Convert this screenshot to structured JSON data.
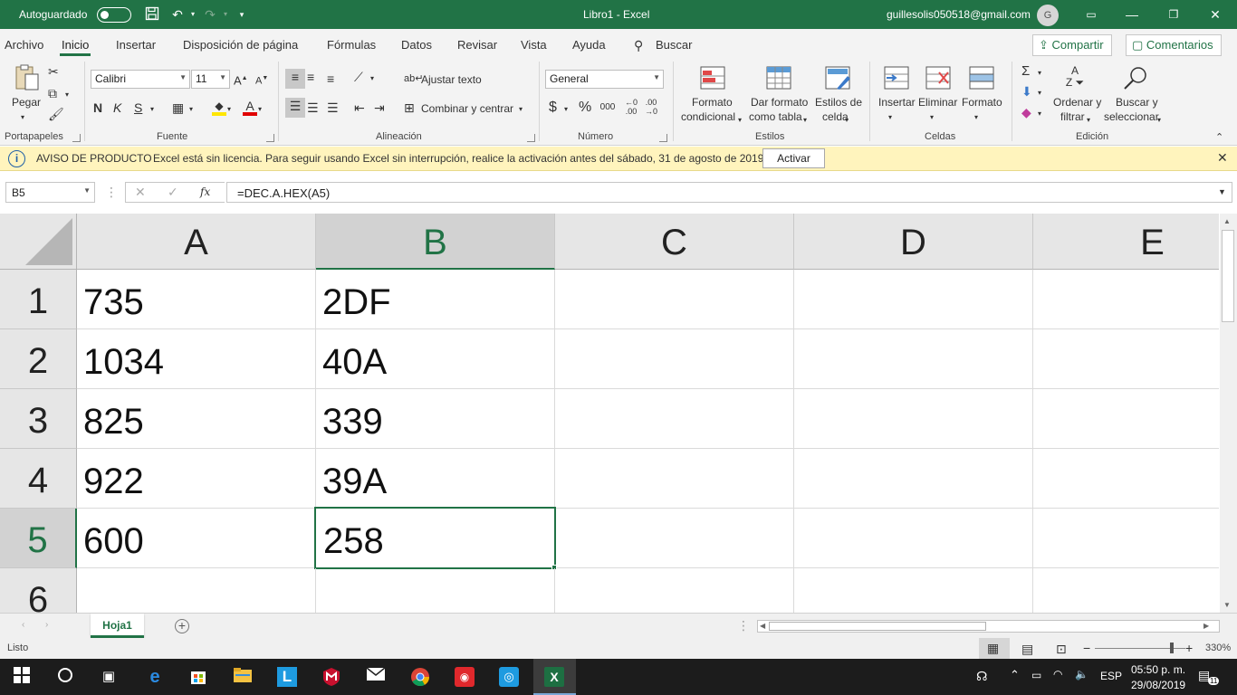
{
  "titlebar": {
    "autosave_label": "Autoguardado",
    "title": "Libro1  -  Excel",
    "account": "guillesolis050518@gmail.com",
    "avatar_initial": "G"
  },
  "menu": {
    "tabs": [
      "Archivo",
      "Inicio",
      "Insertar",
      "Disposición de página",
      "Fórmulas",
      "Datos",
      "Revisar",
      "Vista",
      "Ayuda"
    ],
    "search": "Buscar",
    "share": "Compartir",
    "comments": "Comentarios"
  },
  "ribbon": {
    "clipboard": {
      "paste": "Pegar",
      "group": "Portapapeles"
    },
    "font": {
      "name": "Calibri",
      "size": "11",
      "bold": "N",
      "italic": "K",
      "underline": "S",
      "group": "Fuente"
    },
    "alignment": {
      "wrap": "Ajustar texto",
      "merge": "Combinar y centrar",
      "group": "Alineación"
    },
    "number": {
      "format": "General",
      "currency": "$",
      "percent": "%",
      "thousands": "000",
      "group": "Número"
    },
    "styles": {
      "conditional_1": "Formato",
      "conditional_2": "condicional",
      "table_1": "Dar formato",
      "table_2": "como tabla",
      "cell_1": "Estilos de",
      "cell_2": "celda",
      "group": "Estilos"
    },
    "cells": {
      "insert": "Insertar",
      "delete": "Eliminar",
      "format": "Formato",
      "group": "Celdas"
    },
    "editing": {
      "sort_1": "Ordenar y",
      "sort_2": "filtrar",
      "find_1": "Buscar y",
      "find_2": "seleccionar",
      "group": "Edición"
    }
  },
  "notice": {
    "title": "AVISO DE PRODUCTO",
    "message": "Excel está sin licencia. Para seguir usando Excel sin interrupción, realice la activación antes del sábado, 31 de agosto de 2019.",
    "button": "Activar"
  },
  "formula_bar": {
    "name_box": "B5",
    "fx": "fx",
    "formula": "=DEC.A.HEX(A5)"
  },
  "grid": {
    "columns": [
      "A",
      "B",
      "C",
      "D",
      "E"
    ],
    "rows": [
      "1",
      "2",
      "3",
      "4",
      "5",
      "6"
    ],
    "cells": [
      [
        "735",
        "2DF"
      ],
      [
        "1034",
        "40A"
      ],
      [
        "825",
        "339"
      ],
      [
        "922",
        "39A"
      ],
      [
        "600",
        "258"
      ]
    ],
    "selected_cell": "B5"
  },
  "sheets": {
    "active": "Hoja1"
  },
  "status": {
    "mode": "Listo",
    "zoom": "330%"
  },
  "taskbar": {
    "language": "ESP",
    "time": "05:50 p. m.",
    "date": "29/08/2019",
    "notifications": "11"
  },
  "colors": {
    "accent": "#217346",
    "notice_bg": "#fff4bd",
    "taskbar": "#1c1c1c"
  }
}
